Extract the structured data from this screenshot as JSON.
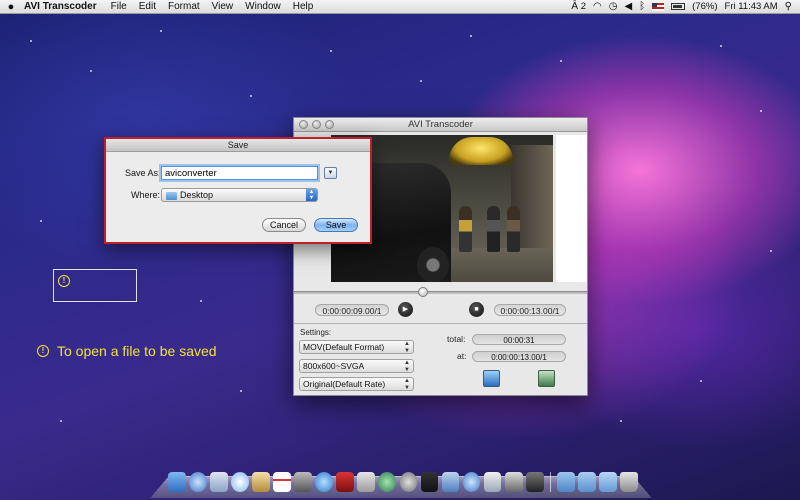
{
  "menubar": {
    "app_name": "AVI Transcoder",
    "menus": [
      "File",
      "Edit",
      "Format",
      "View",
      "Window",
      "Help"
    ],
    "status": {
      "adobe_badge": "2",
      "battery": "(76%)",
      "clock": "Fri 11:43 AM"
    }
  },
  "window": {
    "title": "AVI Transcoder",
    "current_time": "0:00:00:09.00/1",
    "end_time": "0:00:00:13.00/1",
    "settings_label": "Settings:",
    "format_select": "MOV(Default Format)",
    "resolution_select": "800x600~SVGA",
    "rate_select": "Original(Default Rate)",
    "total_label": "total:",
    "total_value": "00:00:31",
    "at_label": "at:",
    "at_value": "0:00:00:13.00/1",
    "seek_position": 0.44
  },
  "dialog": {
    "title": "Save",
    "save_as_label": "Save As:",
    "filename": "aviconverter",
    "where_label": "Where:",
    "location": "Desktop",
    "cancel_label": "Cancel",
    "save_label": "Save"
  },
  "annotation": {
    "tip_text": "To open a file to be saved",
    "tip_glyph": "!"
  },
  "colors": {
    "highlight_border": "#c41e2a",
    "annotation_text": "#f2e33a"
  }
}
